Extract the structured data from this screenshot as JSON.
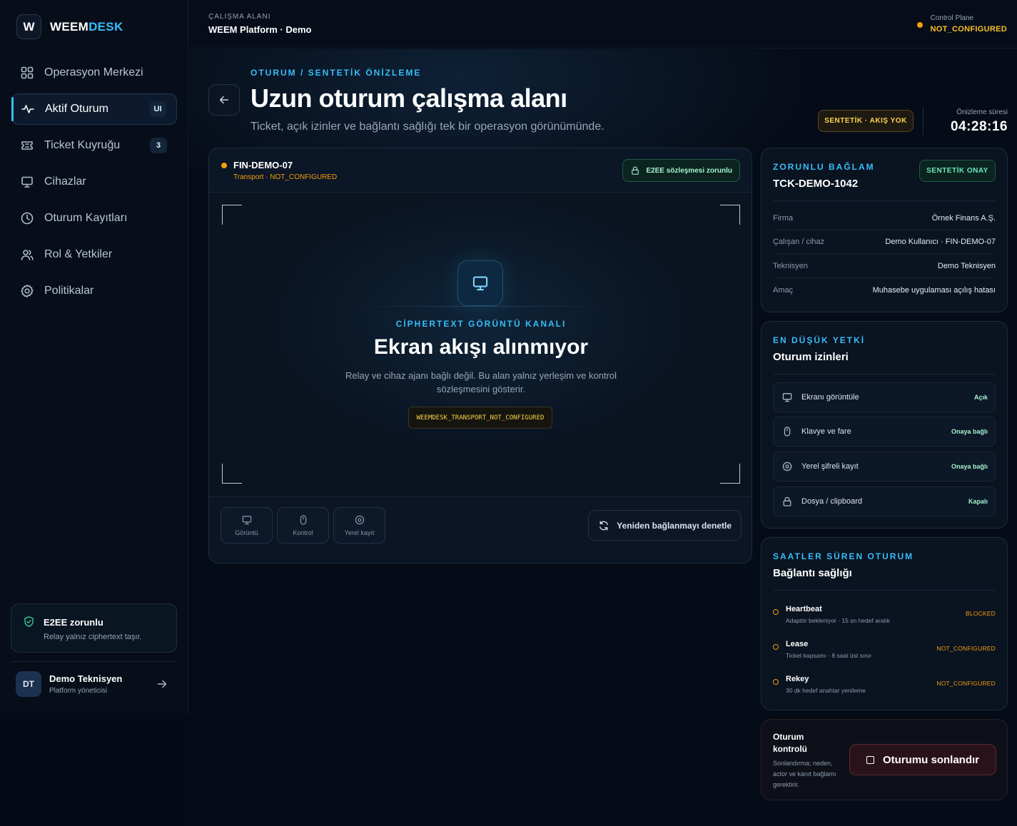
{
  "brand": {
    "logo_letter": "W",
    "name_main": "WEEM",
    "name_accent": "DESK"
  },
  "nav": [
    {
      "label": "Operasyon Merkezi",
      "icon": "grid-icon",
      "active": false,
      "badge": ""
    },
    {
      "label": "Aktif Oturum",
      "icon": "activity-icon",
      "active": true,
      "badge": "UI"
    },
    {
      "label": "Ticket Kuyruğu",
      "icon": "ticket-icon",
      "active": false,
      "badge": "3"
    },
    {
      "label": "Cihazlar",
      "icon": "monitor-icon",
      "active": false,
      "badge": ""
    },
    {
      "label": "Oturum Kayıtları",
      "icon": "clock-icon",
      "active": false,
      "badge": ""
    },
    {
      "label": "Rol & Yetkiler",
      "icon": "users-icon",
      "active": false,
      "badge": ""
    },
    {
      "label": "Politikalar",
      "icon": "gear-icon",
      "active": false,
      "badge": ""
    }
  ],
  "sidebar_notice": {
    "title": "E2EE zorunlu",
    "subtitle": "Relay yalnız ciphertext taşır."
  },
  "user": {
    "initials": "DT",
    "name": "Demo Teknisyen",
    "role": "Platform yöneticisi"
  },
  "topbar": {
    "workspace_label": "ÇALIŞMA ALANI",
    "workspace_value": "WEEM Platform · Demo",
    "control_plane_label": "Control Plane",
    "control_plane_status": "NOT_CONFIGURED"
  },
  "header": {
    "eyebrow": "OTURUM / SENTETİK ÖNİZLEME",
    "title": "Uzun oturum çalışma alanı",
    "subtitle": "Ticket, açık izinler ve bağlantı sağlığı tek bir operasyon görünümünde.",
    "synthetic_chip": "SENTETİK · AKIŞ YOK",
    "timer_label": "Önizleme süresi",
    "timer_value": "04:28:16"
  },
  "viewer": {
    "device_name": "FIN-DEMO-07",
    "device_sub": "Transport · NOT_CONFIGURED",
    "e2ee_chip": "E2EE sözleşmesi zorunlu",
    "channel_label": "CİPHERTEXT GÖRÜNTÜ KANALI",
    "channel_title": "Ekran akışı alınmıyor",
    "channel_desc": "Relay ve cihaz ajanı bağlı değil. Bu alan yalnız yerleşim ve kontrol sözleşmesini gösterir.",
    "code": "WEEMDESK_TRANSPORT_NOT_CONFIGURED",
    "tools": [
      "Görüntü",
      "Kontrol",
      "Yerel kayıt"
    ],
    "reconnect_label": "Yeniden bağlanmayı denetle"
  },
  "context": {
    "eyebrow": "ZORUNLU BAĞLAM",
    "ticket": "TCK-DEMO-1042",
    "approval_chip": "SENTETİK ONAY",
    "rows": [
      {
        "key": "Firma",
        "value": "Örnek Finans A.Ş."
      },
      {
        "key": "Çalışan / cihaz",
        "value": "Demo Kullanıcı · FIN-DEMO-07"
      },
      {
        "key": "Teknisyen",
        "value": "Demo Teknisyen"
      },
      {
        "key": "Amaç",
        "value": "Muhasebe uygulaması açılış hatası"
      }
    ]
  },
  "permissions": {
    "eyebrow": "EN DÜŞÜK YETKİ",
    "title": "Oturum izinleri",
    "items": [
      {
        "label": "Ekranı görüntüle",
        "status": "Açık",
        "icon": "monitor-icon"
      },
      {
        "label": "Klavye ve fare",
        "status": "Onaya bağlı",
        "icon": "mouse-icon"
      },
      {
        "label": "Yerel şifreli kayıt",
        "status": "Onaya bağlı",
        "icon": "record-icon"
      },
      {
        "label": "Dosya / clipboard",
        "status": "Kapalı",
        "icon": "lock-icon"
      }
    ]
  },
  "health": {
    "eyebrow": "SAATLER SÜREN OTURUM",
    "title": "Bağlantı sağlığı",
    "items": [
      {
        "name": "Heartbeat",
        "desc": "Adaptör bekleniyor · 15 sn hedef aralık",
        "status": "BLOCKED"
      },
      {
        "name": "Lease",
        "desc": "Ticket kapsamı · 8 saat üst sınır",
        "status": "NOT_CONFIGURED"
      },
      {
        "name": "Rekey",
        "desc": "30 dk hedef anahtar yenileme",
        "status": "NOT_CONFIGURED"
      }
    ]
  },
  "session_control": {
    "title": "Oturum kontrolü",
    "desc": "Sonlandırma; neden, actor ve kanıt bağlamı gerektirir.",
    "end_button": "Oturumu sonlandır"
  },
  "colors": {
    "accent": "#38bdf8",
    "warning": "#f59e0b",
    "success": "#34d399",
    "danger_border": "#5b2a33"
  }
}
